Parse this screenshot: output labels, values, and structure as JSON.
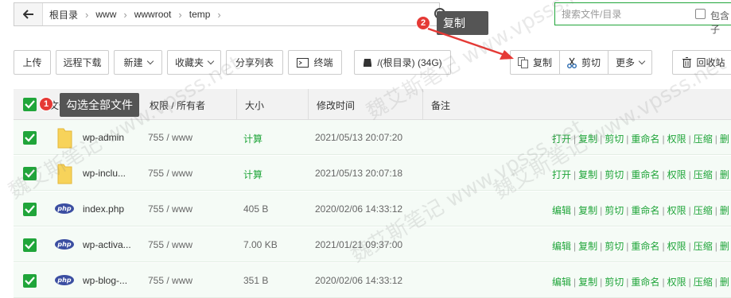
{
  "path": {
    "back_icon": "arrow-left-icon",
    "segments": [
      "根目录",
      "www",
      "wwwroot",
      "temp"
    ]
  },
  "search": {
    "placeholder": "搜索文件/目录",
    "checkbox_label": "包含子"
  },
  "toolbar": {
    "upload": "上传",
    "remote_download": "远程下载",
    "new": "新建",
    "favorites": "收藏夹",
    "share_list": "分享列表",
    "terminal": "终端",
    "disk": "/(根目录) (34G)",
    "copy": "复制",
    "cut": "剪切",
    "more": "更多",
    "recycle": "回收站"
  },
  "table": {
    "headers": {
      "name": "文件名",
      "perm": "权限 / 所有者",
      "size": "大小",
      "mtime": "修改时间",
      "note": "备注"
    },
    "rows": [
      {
        "name": "wp-admin",
        "type": "folder",
        "perm": "755 / www",
        "size": "计算",
        "mtime": "2021/05/13 20:07:20",
        "ops": [
          "打开",
          "复制",
          "剪切",
          "重命名",
          "权限",
          "压缩",
          "删"
        ]
      },
      {
        "name": "wp-inclu...",
        "type": "folder",
        "perm": "755 / www",
        "size": "计算",
        "mtime": "2021/05/13 20:07:18",
        "ops": [
          "打开",
          "复制",
          "剪切",
          "重命名",
          "权限",
          "压缩",
          "删"
        ]
      },
      {
        "name": "index.php",
        "type": "php",
        "perm": "755 / www",
        "size": "405 B",
        "mtime": "2020/02/06 14:33:12",
        "ops": [
          "编辑",
          "复制",
          "剪切",
          "重命名",
          "权限",
          "压缩",
          "删"
        ]
      },
      {
        "name": "wp-activa...",
        "type": "php",
        "perm": "755 / www",
        "size": "7.00 KB",
        "mtime": "2021/01/21 09:37:00",
        "ops": [
          "编辑",
          "复制",
          "剪切",
          "重命名",
          "权限",
          "压缩",
          "删"
        ]
      },
      {
        "name": "wp-blog-...",
        "type": "php",
        "perm": "755 / www",
        "size": "351 B",
        "mtime": "2020/02/06 14:33:12",
        "ops": [
          "编辑",
          "复制",
          "剪切",
          "重命名",
          "权限",
          "压缩",
          "删"
        ]
      }
    ]
  },
  "annotations": {
    "step1_num": "1",
    "step1_text": "勾选全部文件",
    "step2_num": "2",
    "step2_text": "复制"
  },
  "php_icon_text": "php",
  "colors": {
    "accent": "#20a53a",
    "badge": "#e53935",
    "tooltip": "#555555",
    "arrow": "#e53935"
  }
}
